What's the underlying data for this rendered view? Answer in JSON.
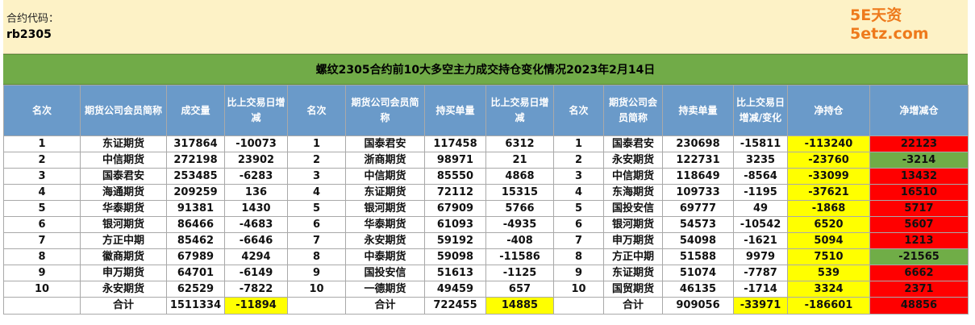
{
  "header": {
    "code_label": "合约代码：",
    "code_value": "rb2305",
    "watermark": "5E天资5etz.com"
  },
  "title": "螺纹2305合约前10大多空主力成交持仓变化情况2023年2月14日",
  "columns": [
    "名次",
    "期货公司会员简称",
    "成交量",
    "比上交易日增减",
    "名次",
    "期货公司会员简称",
    "持买单量",
    "比上交易日增减",
    "名次",
    "期货公司会员简称",
    "持卖单量",
    "比上交易日增减/变化",
    "净持仓",
    "净增减仓"
  ],
  "rows": [
    {
      "r1": "1",
      "n1": "东证期货",
      "v1": "317864",
      "c1": "-10073",
      "r2": "1",
      "n2": "国泰君安",
      "v2": "117458",
      "c2": "6312",
      "r3": "1",
      "n3": "国泰君安",
      "v3": "230698",
      "c3": "-15811",
      "net": "-113240",
      "netc": "22123"
    },
    {
      "r1": "2",
      "n1": "中信期货",
      "v1": "272198",
      "c1": "23902",
      "r2": "2",
      "n2": "浙商期货",
      "v2": "98971",
      "c2": "21",
      "r3": "2",
      "n3": "永安期货",
      "v3": "122731",
      "c3": "3235",
      "net": "-23760",
      "netc": "-3214"
    },
    {
      "r1": "3",
      "n1": "国泰君安",
      "v1": "253485",
      "c1": "-6283",
      "r2": "3",
      "n2": "中信期货",
      "v2": "85550",
      "c2": "4868",
      "r3": "3",
      "n3": "中信期货",
      "v3": "118649",
      "c3": "-8564",
      "net": "-33099",
      "netc": "13432"
    },
    {
      "r1": "4",
      "n1": "海通期货",
      "v1": "209259",
      "c1": "136",
      "r2": "4",
      "n2": "东证期货",
      "v2": "72112",
      "c2": "15315",
      "r3": "4",
      "n3": "东海期货",
      "v3": "109733",
      "c3": "-1195",
      "net": "-37621",
      "netc": "16510"
    },
    {
      "r1": "5",
      "n1": "华泰期货",
      "v1": "91381",
      "c1": "1430",
      "r2": "5",
      "n2": "银河期货",
      "v2": "67909",
      "c2": "5766",
      "r3": "5",
      "n3": "国投安信",
      "v3": "69777",
      "c3": "49",
      "net": "-1868",
      "netc": "5717"
    },
    {
      "r1": "6",
      "n1": "银河期货",
      "v1": "86466",
      "c1": "-4683",
      "r2": "6",
      "n2": "华泰期货",
      "v2": "61093",
      "c2": "-4935",
      "r3": "6",
      "n3": "银河期货",
      "v3": "54573",
      "c3": "-10542",
      "net": "6520",
      "netc": "5607"
    },
    {
      "r1": "7",
      "n1": "方正中期",
      "v1": "85462",
      "c1": "-6646",
      "r2": "7",
      "n2": "永安期货",
      "v2": "59192",
      "c2": "-408",
      "r3": "7",
      "n3": "申万期货",
      "v3": "54098",
      "c3": "-1621",
      "net": "5094",
      "netc": "1213"
    },
    {
      "r1": "8",
      "n1": "徽商期货",
      "v1": "67989",
      "c1": "4294",
      "r2": "8",
      "n2": "中泰期货",
      "v2": "59098",
      "c2": "-11586",
      "r3": "8",
      "n3": "方正中期",
      "v3": "51588",
      "c3": "9979",
      "net": "7510",
      "netc": "-21565"
    },
    {
      "r1": "9",
      "n1": "申万期货",
      "v1": "64701",
      "c1": "-6149",
      "r2": "9",
      "n2": "国投安信",
      "v2": "51613",
      "c2": "-1125",
      "r3": "9",
      "n3": "东证期货",
      "v3": "51074",
      "c3": "-7787",
      "net": "539",
      "netc": "6662"
    },
    {
      "r1": "10",
      "n1": "永安期货",
      "v1": "62529",
      "c1": "-7822",
      "r2": "10",
      "n2": "一德期货",
      "v2": "49459",
      "c2": "657",
      "r3": "10",
      "n3": "国贸期货",
      "v3": "46135",
      "c3": "-1714",
      "net": "3324",
      "netc": "2371"
    }
  ],
  "totals": {
    "label1": "合计",
    "vol": "1511334",
    "vol_change": "-11894",
    "label2": "合计",
    "buy": "722455",
    "buy_change": "14885",
    "label3": "合计",
    "sell": "909056",
    "sell_change": "-33971",
    "net": "-186601",
    "net_change": "48856"
  },
  "colors": {
    "highlight_yellow": "#ffff00",
    "highlight_red": "#ff0000",
    "highlight_green": "#70ad47",
    "text_green": "#1a8a1a",
    "text_red": "#e00000",
    "header_blue": "#6a9ac9",
    "banner_green": "#71ab48"
  }
}
